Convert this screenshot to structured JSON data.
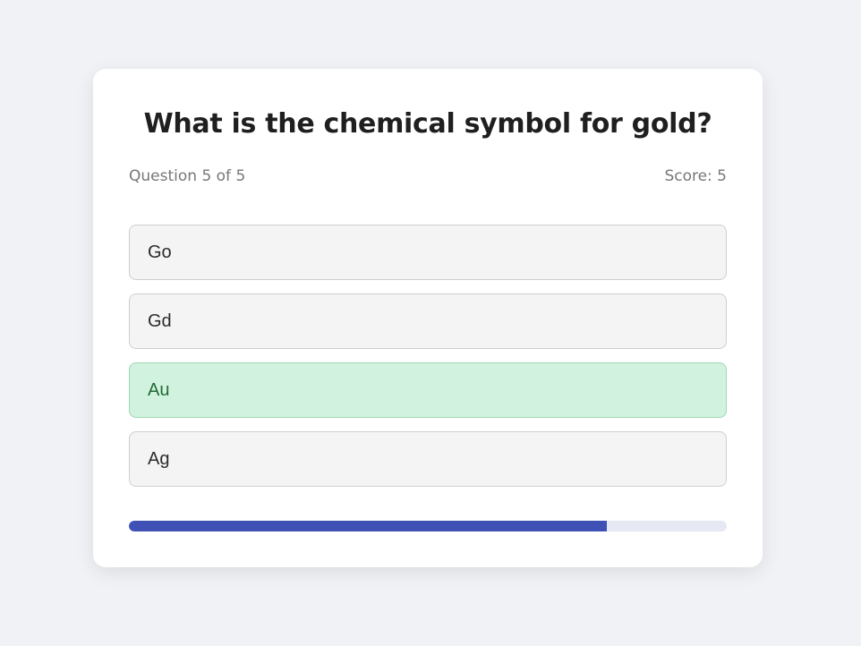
{
  "quiz": {
    "question": "What is the chemical symbol for gold?",
    "progress_label": "Question 5 of 5",
    "score_label": "Score: 5",
    "options": [
      {
        "label": "Go",
        "state": "default"
      },
      {
        "label": "Gd",
        "state": "default"
      },
      {
        "label": "Au",
        "state": "correct"
      },
      {
        "label": "Ag",
        "state": "default"
      }
    ],
    "progress_fraction": 0.8
  },
  "colors": {
    "page_background": "#f0f2f5",
    "card_background": "#ffffff",
    "correct_background": "#d1f2de",
    "correct_text": "#226b36",
    "progress_fill": "#3f51b5",
    "progress_track": "#e6e8f4"
  }
}
